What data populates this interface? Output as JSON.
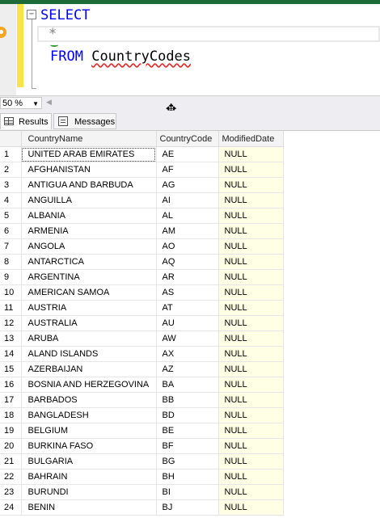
{
  "editor": {
    "line1_keyword": "SELECT",
    "line2_star": "*",
    "line3_keyword": "FROM",
    "line3_table": "CountryCodes"
  },
  "zoom": {
    "value": "50 %"
  },
  "tabs": {
    "results": "Results",
    "messages": "Messages"
  },
  "grid": {
    "columns": [
      "CountryName",
      "CountryCode",
      "ModifiedDate"
    ],
    "rows": [
      [
        "1",
        "UNITED ARAB EMIRATES",
        "AE",
        "NULL"
      ],
      [
        "2",
        "AFGHANISTAN",
        "AF",
        "NULL"
      ],
      [
        "3",
        "ANTIGUA AND BARBUDA",
        "AG",
        "NULL"
      ],
      [
        "4",
        "ANGUILLA",
        "AI",
        "NULL"
      ],
      [
        "5",
        "ALBANIA",
        "AL",
        "NULL"
      ],
      [
        "6",
        "ARMENIA",
        "AM",
        "NULL"
      ],
      [
        "7",
        "ANGOLA",
        "AO",
        "NULL"
      ],
      [
        "8",
        "ANTARCTICA",
        "AQ",
        "NULL"
      ],
      [
        "9",
        "ARGENTINA",
        "AR",
        "NULL"
      ],
      [
        "10",
        "AMERICAN SAMOA",
        "AS",
        "NULL"
      ],
      [
        "11",
        "AUSTRIA",
        "AT",
        "NULL"
      ],
      [
        "12",
        "AUSTRALIA",
        "AU",
        "NULL"
      ],
      [
        "13",
        "ARUBA",
        "AW",
        "NULL"
      ],
      [
        "14",
        "ALAND ISLANDS",
        "AX",
        "NULL"
      ],
      [
        "15",
        "AZERBAIJAN",
        "AZ",
        "NULL"
      ],
      [
        "16",
        "BOSNIA AND HERZEGOVINA",
        "BA",
        "NULL"
      ],
      [
        "17",
        "BARBADOS",
        "BB",
        "NULL"
      ],
      [
        "18",
        "BANGLADESH",
        "BD",
        "NULL"
      ],
      [
        "19",
        "BELGIUM",
        "BE",
        "NULL"
      ],
      [
        "20",
        "BURKINA FASO",
        "BF",
        "NULL"
      ],
      [
        "21",
        "BULGARIA",
        "BG",
        "NULL"
      ],
      [
        "22",
        "BAHRAIN",
        "BH",
        "NULL"
      ],
      [
        "23",
        "BURUNDI",
        "BI",
        "NULL"
      ],
      [
        "24",
        "BENIN",
        "BJ",
        "NULL"
      ]
    ]
  },
  "colors": {
    "keyword": "#0000ff",
    "null_column_bg": "#ffffe6",
    "editor_margin": "#f5e44a"
  }
}
